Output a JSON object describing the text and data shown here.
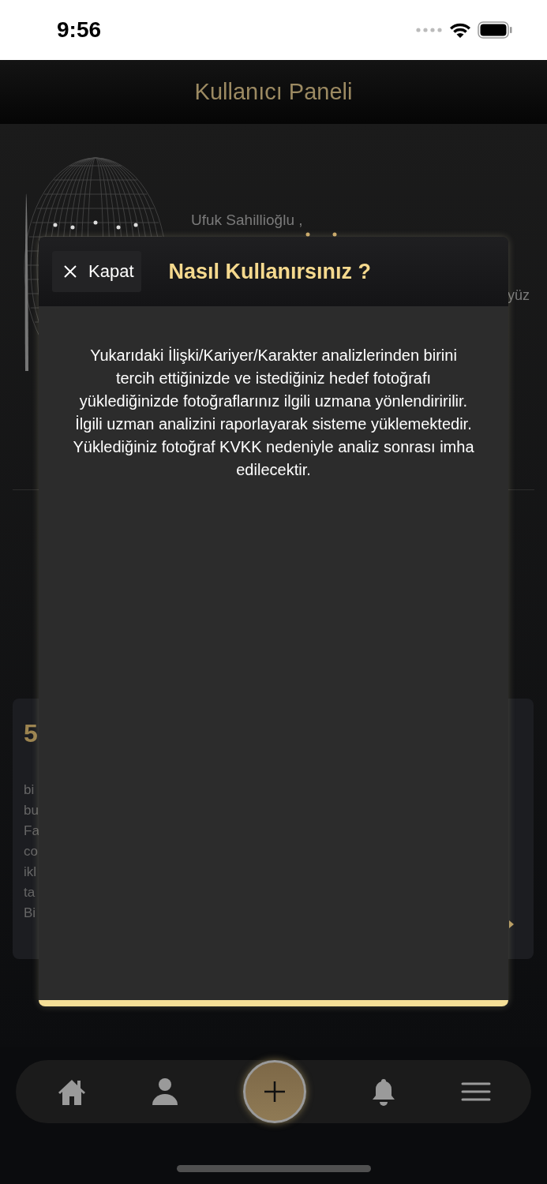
{
  "status_bar": {
    "time": "9:56"
  },
  "header": {
    "title": "Kullanıcı Paneli"
  },
  "profile": {
    "name": "Ufuk Sahillioğlu ,",
    "side_text": "yüz"
  },
  "card": {
    "number": "5",
    "lines": [
      "bi",
      "bu",
      "Fa",
      "co",
      "ikl",
      "ta",
      "Bi"
    ]
  },
  "modal": {
    "close_label": "Kapat",
    "title": "Nasıl Kullanırsınız ?",
    "body": "Yukarıdaki İlişki/Kariyer/Karakter analizlerinden birini tercih ettiğinizde ve istediğiniz hedef fotoğrafı yüklediğinizde fotoğraflarınız ilgili uzmana yönlendiririlir. İlgili uzman analizini raporlayarak sisteme yüklemektedir. Yüklediğiniz fotoğraf KVKK nedeniyle analiz sonrası imha edilecektir."
  },
  "nav": {
    "items": [
      {
        "kind": "home"
      },
      {
        "kind": "profile"
      },
      {
        "kind": "add"
      },
      {
        "kind": "notifications"
      },
      {
        "kind": "menu"
      }
    ]
  }
}
